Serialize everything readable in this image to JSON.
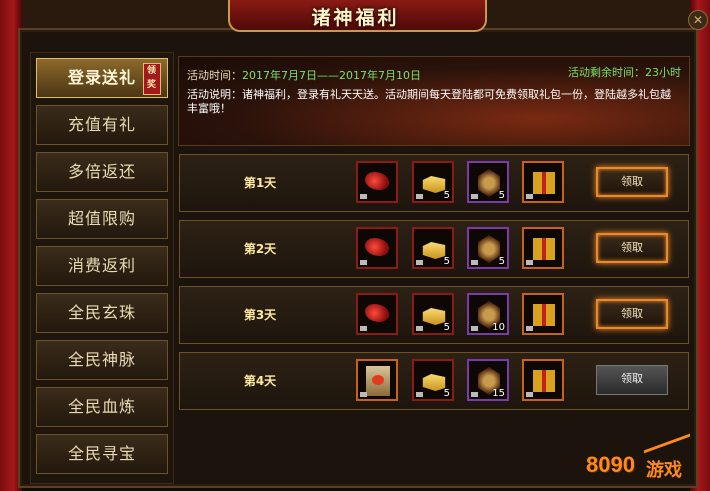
{
  "window": {
    "title": "诸神福利",
    "close_glyph": "✕"
  },
  "sidebar": {
    "items": [
      {
        "label": "登录送礼",
        "active": true,
        "badge": "领奖"
      },
      {
        "label": "充值有礼"
      },
      {
        "label": "多倍返还"
      },
      {
        "label": "超值限购"
      },
      {
        "label": "消费返利"
      },
      {
        "label": "全民玄珠"
      },
      {
        "label": "全民神脉"
      },
      {
        "label": "全民血炼"
      },
      {
        "label": "全民寻宝"
      }
    ]
  },
  "info": {
    "time_label": "活动时间：",
    "time_value": "2017年7月7日——2017年7月10日",
    "remaining": "活动剩余时间：23小时",
    "desc": "活动说明：诸神福利，登录有礼天天送。活动期间每天登陆都可免费领取礼包一份，登陆越多礼包越丰富哦！"
  },
  "rows": [
    {
      "day": "第1天",
      "items": [
        {
          "icon": "mount-icon",
          "count": ""
        },
        {
          "icon": "gold-ingot-icon",
          "count": "5"
        },
        {
          "icon": "medal-icon",
          "count": "5"
        },
        {
          "icon": "gift-box-icon",
          "count": ""
        }
      ],
      "button": "领取"
    },
    {
      "day": "第2天",
      "items": [
        {
          "icon": "mount-icon",
          "count": ""
        },
        {
          "icon": "gold-ingot-icon",
          "count": "5"
        },
        {
          "icon": "medal-icon",
          "count": "5"
        },
        {
          "icon": "gift-box-icon",
          "count": ""
        }
      ],
      "button": "领取"
    },
    {
      "day": "第3天",
      "items": [
        {
          "icon": "mount-icon",
          "count": ""
        },
        {
          "icon": "gold-ingot-icon",
          "count": "5"
        },
        {
          "icon": "medal-icon",
          "count": "10"
        },
        {
          "icon": "gift-box-icon",
          "count": ""
        }
      ],
      "button": "领取"
    },
    {
      "day": "第4天",
      "items": [
        {
          "icon": "scroll-book-icon",
          "count": ""
        },
        {
          "icon": "gold-ingot-icon",
          "count": "5"
        },
        {
          "icon": "medal-icon",
          "count": "15"
        },
        {
          "icon": "gift-box-icon",
          "count": ""
        }
      ],
      "button": "领取"
    }
  ],
  "watermark": {
    "number": "8090",
    "text": "游戏"
  },
  "colors": {
    "accent_gold": "#e4bd6c",
    "highlight_green": "#7be26b",
    "frame_red": "#a8161a"
  }
}
